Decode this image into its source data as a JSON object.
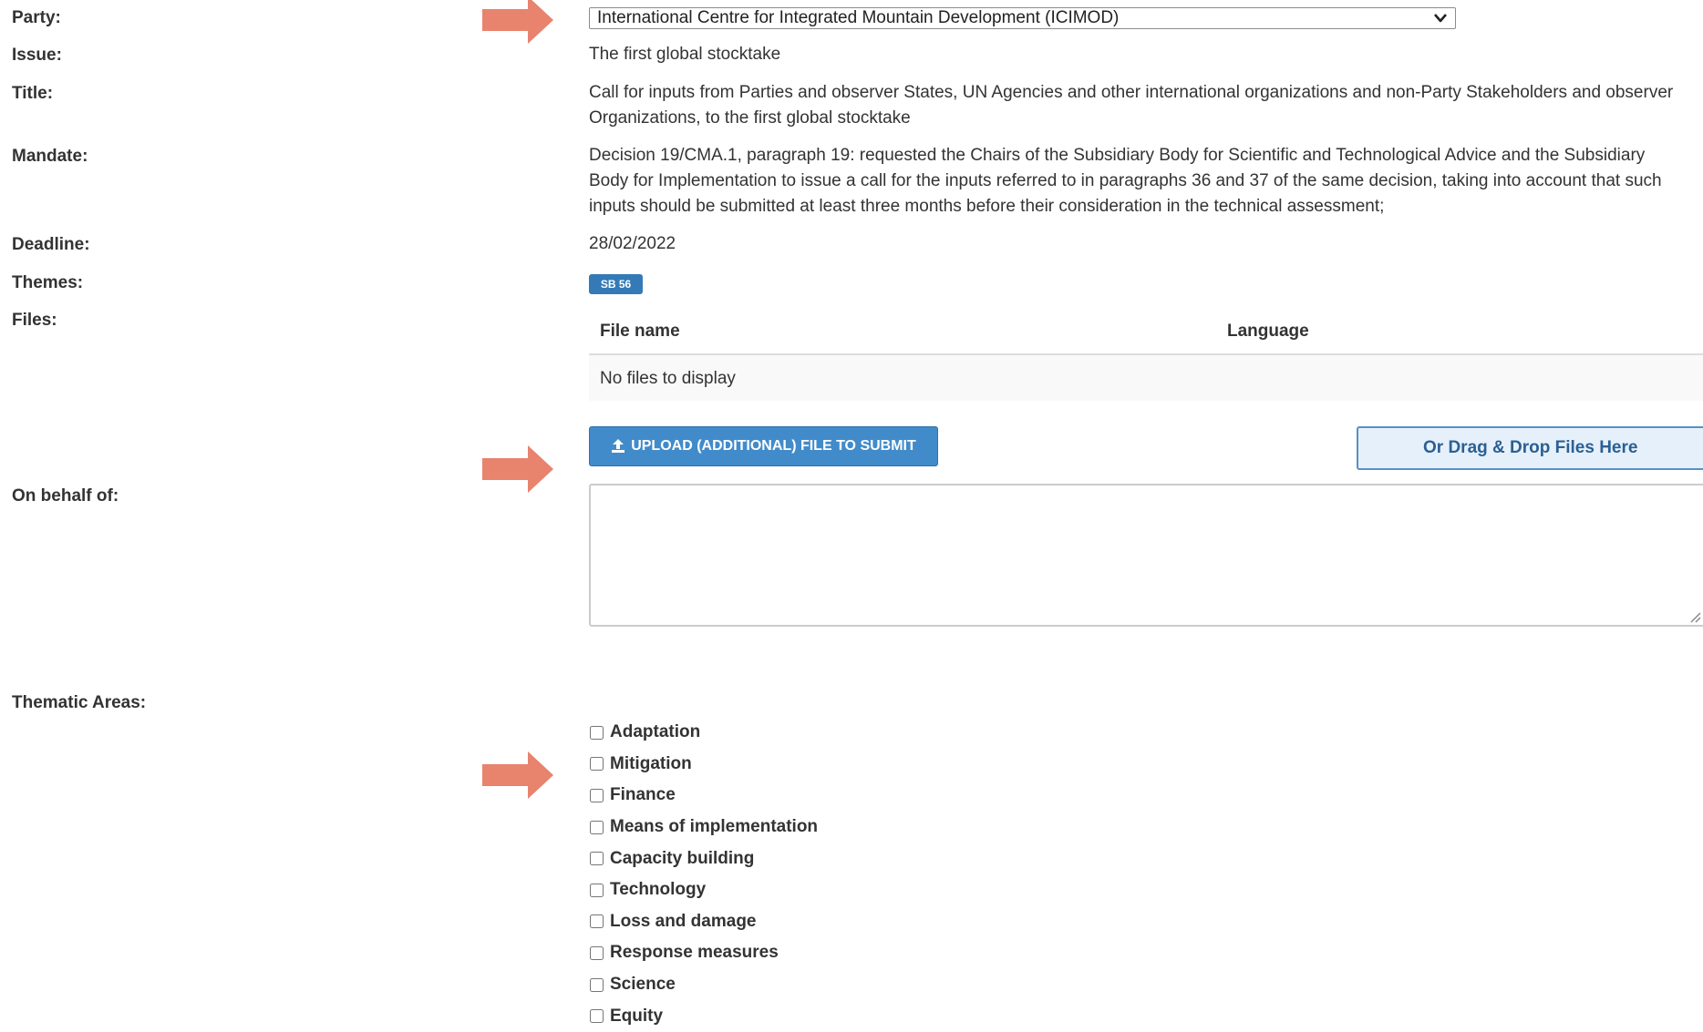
{
  "labels": {
    "party": "Party:",
    "issue": "Issue:",
    "title": "Title:",
    "mandate": "Mandate:",
    "deadline": "Deadline:",
    "themes": "Themes:",
    "files": "Files:",
    "on_behalf_of": "On behalf of:",
    "thematic_areas": "Thematic Areas:"
  },
  "party": {
    "selected": "International Centre for Integrated Mountain Development (ICIMOD)"
  },
  "issue": "The first global stocktake",
  "title": {
    "line1": "Call for inputs from Parties and observer States, UN Agencies and other international organizations and non-Party Stakeholders and observer",
    "line2": "Organizations, to the first global stocktake"
  },
  "mandate": {
    "line1": "Decision 19/CMA.1, paragraph 19: requested the Chairs of the Subsidiary Body for Scientific and Technological Advice and the Subsidiary",
    "line2": "Body for Implementation to issue a call for the inputs referred to in paragraphs 36 and 37 of the same decision, taking into account that such",
    "line3": "inputs should be submitted at least three months before their consideration in the technical assessment;"
  },
  "deadline": "28/02/2022",
  "themes": {
    "badge": "SB 56"
  },
  "files": {
    "columns": [
      "File name",
      "Language"
    ],
    "empty_text": "No files to display"
  },
  "upload": {
    "button_label": "UPLOAD (ADDITIONAL) FILE TO SUBMIT",
    "dropzone_label": "Or Drag & Drop Files Here"
  },
  "on_behalf_of": {
    "value": ""
  },
  "thematic_areas": [
    {
      "label": "Adaptation",
      "checked": false
    },
    {
      "label": "Mitigation",
      "checked": false
    },
    {
      "label": "Finance",
      "checked": false
    },
    {
      "label": "Means of implementation",
      "checked": false
    },
    {
      "label": "Capacity building",
      "checked": false
    },
    {
      "label": "Technology",
      "checked": false
    },
    {
      "label": "Loss and damage",
      "checked": false
    },
    {
      "label": "Response measures",
      "checked": false
    },
    {
      "label": "Science",
      "checked": false
    },
    {
      "label": "Equity",
      "checked": false
    }
  ],
  "colors": {
    "arrow": "#e8836e",
    "primary_button": "#428bca",
    "badge": "#337ab7",
    "dropzone_bg": "#e6f0fa",
    "dropzone_border": "#5a8fc4"
  }
}
